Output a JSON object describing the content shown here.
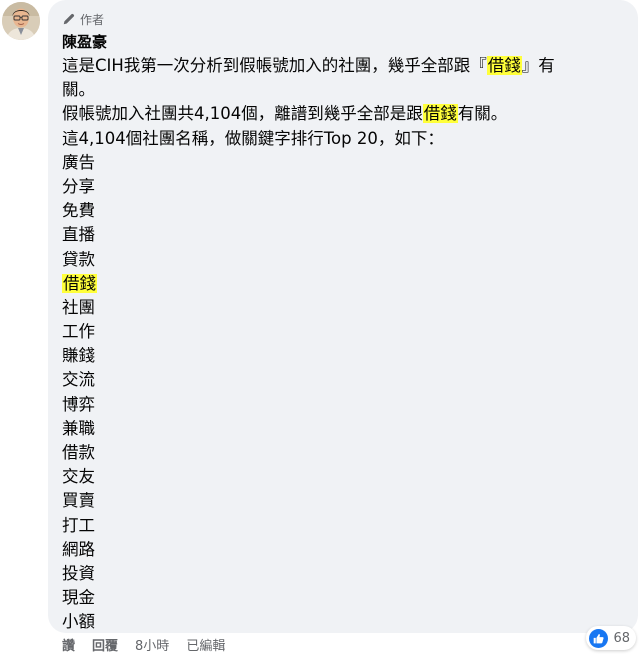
{
  "comment": {
    "badge_label": "作者",
    "author_name": "陳盈豪",
    "paragraph1_line1_before": "這是CIH我第一次分析到假帳號加入的社團，幾乎全部跟『",
    "paragraph1_line1_highlight": "借錢",
    "paragraph1_line1_after": "』有",
    "paragraph1_line2": "關。",
    "paragraph2_before": "假帳號加入社團共4,104個，離譜到幾乎全部是跟",
    "paragraph2_highlight": "借錢",
    "paragraph2_after": "有關。",
    "paragraph3": "這4,104個社團名稱，做關鍵字排行Top 20，如下：",
    "keywords": [
      {
        "text": "廣告",
        "highlight": false
      },
      {
        "text": "分享",
        "highlight": false
      },
      {
        "text": "免費",
        "highlight": false
      },
      {
        "text": "直播",
        "highlight": false
      },
      {
        "text": "貸款",
        "highlight": false
      },
      {
        "text": "借錢",
        "highlight": true
      },
      {
        "text": "社團",
        "highlight": false
      },
      {
        "text": "工作",
        "highlight": false
      },
      {
        "text": "賺錢",
        "highlight": false
      },
      {
        "text": "交流",
        "highlight": false
      },
      {
        "text": "博弈",
        "highlight": false
      },
      {
        "text": "兼職",
        "highlight": false
      },
      {
        "text": "借款",
        "highlight": false
      },
      {
        "text": "交友",
        "highlight": false
      },
      {
        "text": "買賣",
        "highlight": false
      },
      {
        "text": "打工",
        "highlight": false
      },
      {
        "text": "網路",
        "highlight": false
      },
      {
        "text": "投資",
        "highlight": false
      },
      {
        "text": "現金",
        "highlight": false
      },
      {
        "text": "小額",
        "highlight": false
      }
    ],
    "highlight_color": "#ffff3a"
  },
  "actions": {
    "like_label": "讚",
    "reply_label": "回覆",
    "time_label": "8小時",
    "edited_label": "已編輯"
  },
  "reactions": {
    "icon": "thumbs-up-icon",
    "count": "68",
    "accent_color": "#1877f2"
  }
}
